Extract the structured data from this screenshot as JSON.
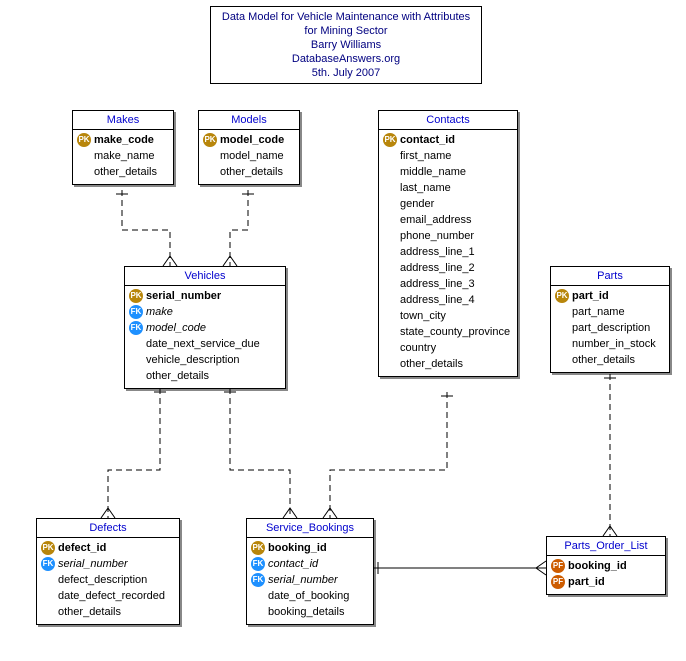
{
  "title": {
    "line1": "Data Model for Vehicle Maintenance with Attributes",
    "line2": "for Mining Sector",
    "author": "Barry Williams",
    "org": "DatabaseAnswers.org",
    "date": "5th. July  2007"
  },
  "entities": {
    "makes": {
      "name": "Makes",
      "pk_label": "PK",
      "attrs": {
        "make_code": "make_code",
        "make_name": "make_name",
        "other_details": "other_details"
      }
    },
    "models": {
      "name": "Models",
      "pk_label": "PK",
      "attrs": {
        "model_code": "model_code",
        "model_name": "model_name",
        "other_details": "other_details"
      }
    },
    "contacts": {
      "name": "Contacts",
      "pk_label": "PK",
      "attrs": {
        "contact_id": "contact_id",
        "first_name": "first_name",
        "middle_name": "middle_name",
        "last_name": "last_name",
        "gender": "gender",
        "email_address": "email_address",
        "phone_number": "phone_number",
        "address_line_1": "address_line_1",
        "address_line_2": "address_line_2",
        "address_line_3": "address_line_3",
        "address_line_4": "address_line_4",
        "town_city": "town_city",
        "state_county_province": "state_county_province",
        "country": "country",
        "other_details": "other_details"
      }
    },
    "parts": {
      "name": "Parts",
      "pk_label": "PK",
      "attrs": {
        "part_id": "part_id",
        "part_name": "part_name",
        "part_description": "part_description",
        "number_in_stock": "number_in_stock",
        "other_details": "other_details"
      }
    },
    "vehicles": {
      "name": "Vehicles",
      "pk_label": "PK",
      "fk_label": "FK",
      "attrs": {
        "serial_number": "serial_number",
        "make": "make",
        "model_code": "model_code",
        "date_next_service_due": "date_next_service_due",
        "vehicle_description": "vehicle_description",
        "other_details": "other_details"
      }
    },
    "defects": {
      "name": "Defects",
      "pk_label": "PK",
      "fk_label": "FK",
      "attrs": {
        "defect_id": "defect_id",
        "serial_number": "serial_number",
        "defect_description": "defect_description",
        "date_defect_recorded": "date_defect_recorded",
        "other_details": "other_details"
      }
    },
    "service_bookings": {
      "name": "Service_Bookings",
      "pk_label": "PK",
      "fk_label": "FK",
      "attrs": {
        "booking_id": "booking_id",
        "contact_id": "contact_id",
        "serial_number": "serial_number",
        "date_of_booking": "date_of_booking",
        "booking_details": "booking_details"
      }
    },
    "parts_order_list": {
      "name": "Parts_Order_List",
      "pf_label": "PF",
      "attrs": {
        "booking_id": "booking_id",
        "part_id": "part_id"
      }
    }
  },
  "chart_data": {
    "type": "table",
    "title": "Data Model for Vehicle Maintenance with Attributes for Mining Sector",
    "entities": [
      {
        "name": "Makes",
        "pk": [
          "make_code"
        ],
        "attrs": [
          "make_name",
          "other_details"
        ]
      },
      {
        "name": "Models",
        "pk": [
          "model_code"
        ],
        "attrs": [
          "model_name",
          "other_details"
        ]
      },
      {
        "name": "Contacts",
        "pk": [
          "contact_id"
        ],
        "attrs": [
          "first_name",
          "middle_name",
          "last_name",
          "gender",
          "email_address",
          "phone_number",
          "address_line_1",
          "address_line_2",
          "address_line_3",
          "address_line_4",
          "town_city",
          "state_county_province",
          "country",
          "other_details"
        ]
      },
      {
        "name": "Parts",
        "pk": [
          "part_id"
        ],
        "attrs": [
          "part_name",
          "part_description",
          "number_in_stock",
          "other_details"
        ]
      },
      {
        "name": "Vehicles",
        "pk": [
          "serial_number"
        ],
        "fk": [
          "make",
          "model_code"
        ],
        "attrs": [
          "date_next_service_due",
          "vehicle_description",
          "other_details"
        ]
      },
      {
        "name": "Defects",
        "pk": [
          "defect_id"
        ],
        "fk": [
          "serial_number"
        ],
        "attrs": [
          "defect_description",
          "date_defect_recorded",
          "other_details"
        ]
      },
      {
        "name": "Service_Bookings",
        "pk": [
          "booking_id"
        ],
        "fk": [
          "contact_id",
          "serial_number"
        ],
        "attrs": [
          "date_of_booking",
          "booking_details"
        ]
      },
      {
        "name": "Parts_Order_List",
        "pfk": [
          "booking_id",
          "part_id"
        ]
      }
    ],
    "relationships": [
      {
        "from": "Makes",
        "to": "Vehicles",
        "type": "one-to-many"
      },
      {
        "from": "Models",
        "to": "Vehicles",
        "type": "one-to-many"
      },
      {
        "from": "Vehicles",
        "to": "Defects",
        "type": "one-to-many"
      },
      {
        "from": "Vehicles",
        "to": "Service_Bookings",
        "type": "one-to-many"
      },
      {
        "from": "Contacts",
        "to": "Service_Bookings",
        "type": "one-to-many"
      },
      {
        "from": "Service_Bookings",
        "to": "Parts_Order_List",
        "type": "one-to-many"
      },
      {
        "from": "Parts",
        "to": "Parts_Order_List",
        "type": "one-to-many"
      }
    ]
  }
}
